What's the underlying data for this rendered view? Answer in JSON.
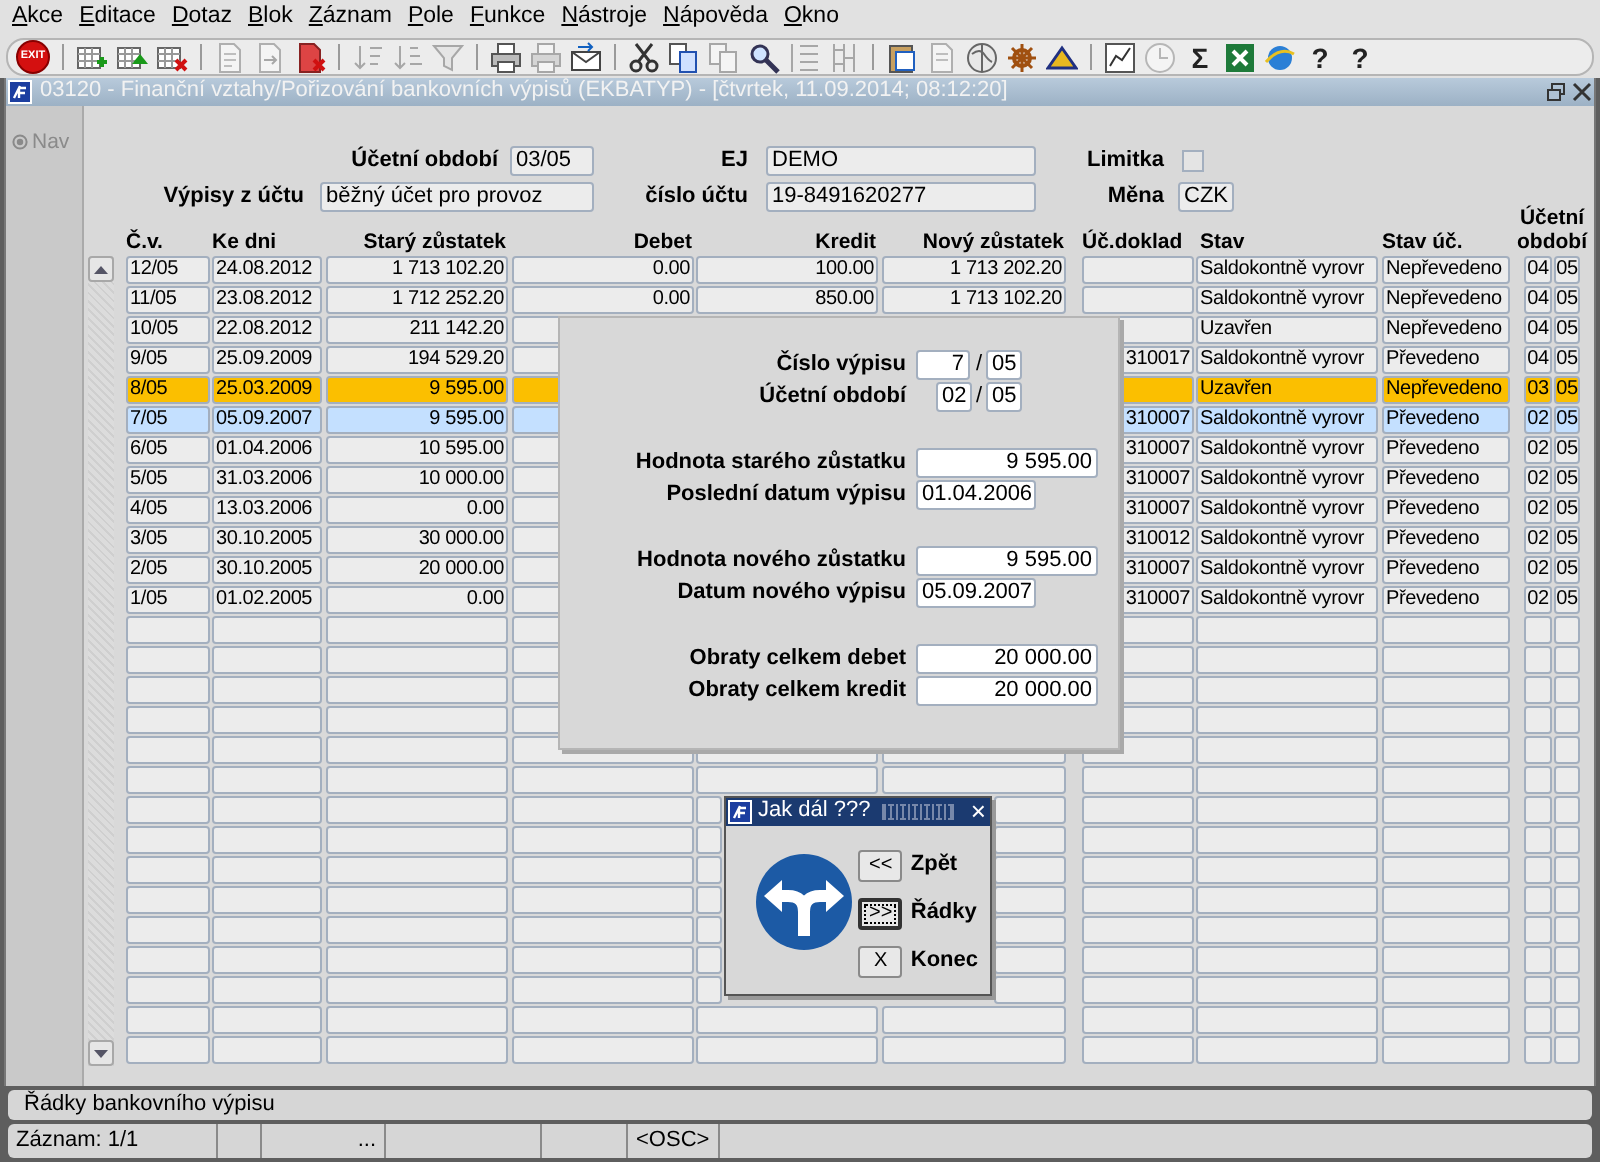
{
  "menu": [
    {
      "label": "Akce"
    },
    {
      "label": "Editace"
    },
    {
      "label": "Dotaz"
    },
    {
      "label": "Blok"
    },
    {
      "label": "Záznam"
    },
    {
      "label": "Pole"
    },
    {
      "label": "Funkce"
    },
    {
      "label": "Nástroje"
    },
    {
      "label": "Nápověda"
    },
    {
      "label": "Okno"
    }
  ],
  "toolbar": {
    "groups": [
      [
        {
          "label": "EXIT",
          "disabled": false
        }
      ],
      [
        {
          "disabled": false
        },
        {
          "disabled": false
        },
        {
          "disabled": false
        }
      ],
      [
        {
          "disabled": true
        },
        {
          "disabled": true
        },
        {
          "disabled": false
        }
      ],
      [
        {
          "disabled": true
        },
        {
          "disabled": true
        },
        {
          "disabled": true
        }
      ],
      [
        {
          "disabled": false
        },
        {
          "disabled": true
        },
        {
          "disabled": false
        }
      ],
      [
        {
          "disabled": false
        },
        {
          "disabled": false
        },
        {
          "disabled": true
        },
        {
          "disabled": false
        },
        {
          "disabled": true
        },
        {
          "disabled": true
        }
      ],
      [
        {
          "disabled": false
        },
        {
          "disabled": true
        },
        {
          "disabled": false
        },
        {
          "disabled": false
        },
        {
          "disabled": false
        }
      ],
      [
        {
          "disabled": false
        },
        {
          "disabled": true
        },
        {
          "label": "Σ",
          "disabled": false
        },
        {
          "disabled": false
        },
        {
          "disabled": false
        },
        {
          "label": "?",
          "disabled": false
        },
        {
          "label": "?",
          "disabled": false
        }
      ]
    ]
  },
  "window": {
    "title": "03120 - Finanční vztahy/Pořizování bankovních výpisů (EKBATYP) - [čtvrtek, 11.09.2014; 08:12:20]"
  },
  "nav": {
    "label": "Nav"
  },
  "header": {
    "accounting_period": {
      "label": "Účetní období",
      "value": "03/05"
    },
    "ej": {
      "label": "EJ",
      "value": "DEMO"
    },
    "limitka": {
      "label": "Limitka",
      "checked": false
    },
    "statements_of_account": {
      "label": "Výpisy z účtu",
      "value": "běžný účet pro provoz"
    },
    "account_number": {
      "label": "číslo účtu",
      "value": "19-8491620277"
    },
    "currency": {
      "label": "Měna",
      "value": "CZK"
    }
  },
  "table": {
    "columns": [
      "Č.v.",
      "Ke dni",
      "Starý zůstatek",
      "Debet",
      "Kredit",
      "Nový zůstatek",
      "Úč.doklad",
      "Stav",
      "Stav úč.",
      "Účetní období"
    ],
    "rows": [
      {
        "cv": "12/05",
        "date": "24.08.2012",
        "old_balance": "1 713 102.20",
        "debit": "0.00",
        "credit": "100.00",
        "new_balance": "1 713 202.20",
        "status": "Saldokontně vyrovr",
        "accounting_status": "Nepřevedeno",
        "period_month": "04",
        "period_year": "05",
        "selected": false,
        "current": false
      },
      {
        "cv": "11/05",
        "date": "23.08.2012",
        "old_balance": "1 712 252.20",
        "debit": "0.00",
        "credit": "850.00",
        "new_balance": "1 713 102.20",
        "status": "Saldokontně vyrovr",
        "accounting_status": "Nepřevedeno",
        "period_month": "04",
        "period_year": "05",
        "selected": false,
        "current": false
      },
      {
        "cv": "10/05",
        "date": "22.08.2012",
        "old_balance": "211 142.20",
        "status": "Uzavřen",
        "accounting_status": "Nepřevedeno",
        "period_month": "04",
        "period_year": "05",
        "selected": false,
        "current": false
      },
      {
        "cv": "9/05",
        "date": "25.09.2009",
        "old_balance": "194 529.20",
        "document": "310017",
        "status": "Saldokontně vyrovr",
        "accounting_status": "Převedeno",
        "period_month": "04",
        "period_year": "05",
        "selected": false,
        "current": false
      },
      {
        "cv": "8/05",
        "date": "25.03.2009",
        "old_balance": "9 595.00",
        "status": "Uzavřen",
        "accounting_status": "Nepřevedeno",
        "period_month": "03",
        "period_year": "05",
        "selected": true,
        "current": false
      },
      {
        "cv": "7/05",
        "date": "05.09.2007",
        "old_balance": "9 595.00",
        "document": "310007",
        "status": "Saldokontně vyrovr",
        "accounting_status": "Převedeno",
        "period_month": "02",
        "period_year": "05",
        "selected": false,
        "current": true
      },
      {
        "cv": "6/05",
        "date": "01.04.2006",
        "old_balance": "10 595.00",
        "document": "310007",
        "status": "Saldokontně vyrovr",
        "accounting_status": "Převedeno",
        "period_month": "02",
        "period_year": "05",
        "selected": false,
        "current": false
      },
      {
        "cv": "5/05",
        "date": "31.03.2006",
        "old_balance": "10 000.00",
        "document": "310007",
        "status": "Saldokontně vyrovr",
        "accounting_status": "Převedeno",
        "period_month": "02",
        "period_year": "05",
        "selected": false,
        "current": false
      },
      {
        "cv": "4/05",
        "date": "13.03.2006",
        "old_balance": "0.00",
        "document": "310007",
        "status": "Saldokontně vyrovr",
        "accounting_status": "Převedeno",
        "period_month": "02",
        "period_year": "05",
        "selected": false,
        "current": false
      },
      {
        "cv": "3/05",
        "date": "30.10.2005",
        "old_balance": "30 000.00",
        "document": "310012",
        "status": "Saldokontně vyrovr",
        "accounting_status": "Převedeno",
        "period_month": "02",
        "period_year": "05",
        "selected": false,
        "current": false
      },
      {
        "cv": "2/05",
        "date": "30.10.2005",
        "old_balance": "20 000.00",
        "document": "310007",
        "status": "Saldokontně vyrovr",
        "accounting_status": "Převedeno",
        "period_month": "02",
        "period_year": "05",
        "selected": false,
        "current": false
      },
      {
        "cv": "1/05",
        "date": "01.02.2005",
        "old_balance": "0.00",
        "document": "310007",
        "status": "Saldokontně vyrovr",
        "accounting_status": "Převedeno",
        "period_month": "02",
        "period_year": "05",
        "selected": false,
        "current": false
      }
    ]
  },
  "panel": {
    "groups": [
      [
        {
          "kind": "number_pair",
          "label": "Číslo výpisu",
          "value": "7",
          "separator": "/",
          "value_2": "05"
        },
        {
          "kind": "period_pair",
          "label": "Účetní období",
          "value": "02",
          "separator": "/",
          "value_2": "05"
        }
      ],
      [
        {
          "kind": "amount",
          "label": "Hodnota starého zůstatku",
          "value": "9 595.00"
        },
        {
          "kind": "date",
          "label": "Poslední datum výpisu",
          "value": "01.04.2006"
        }
      ],
      [
        {
          "kind": "amount",
          "label": "Hodnota nového zůstatku",
          "value": "9 595.00"
        },
        {
          "kind": "date",
          "label": "Datum nového výpisu",
          "value": "05.09.2007"
        }
      ],
      [
        {
          "kind": "amount",
          "label": "Obraty celkem debet",
          "value": "20 000.00"
        },
        {
          "kind": "amount",
          "label": "Obraty celkem kredit",
          "value": "20 000.00"
        }
      ]
    ]
  },
  "dialog": {
    "title": "Jak dál ???",
    "close": "×",
    "buttons": [
      {
        "key": "<<",
        "label": "Zpět",
        "focused": false
      },
      {
        "key": ">>",
        "label": "Řádky",
        "focused": true
      },
      {
        "key": "X",
        "label": "Konec",
        "focused": false
      }
    ]
  },
  "status_bar": {
    "message": "Řádky bankovního výpisu",
    "record": "Záznam: 1/1",
    "field_3": "...",
    "mode": "<OSC>"
  }
}
